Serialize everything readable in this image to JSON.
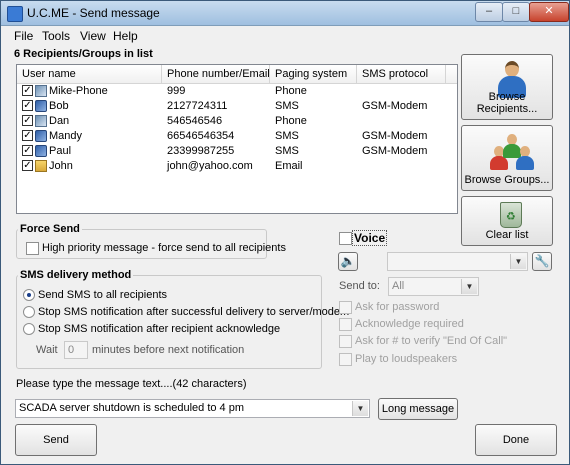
{
  "window": {
    "title": "U.C.ME - Send message"
  },
  "menu": [
    "File",
    "Tools",
    "View",
    "Help"
  ],
  "recipients": {
    "heading": "6 Recipients/Groups in list",
    "columns": [
      "User name",
      "Phone number/Email",
      "Paging system",
      "SMS protocol"
    ],
    "rows": [
      {
        "name": "Mike-Phone",
        "number": "999",
        "system": "Phone",
        "protocol": "",
        "icon": "phone-icon"
      },
      {
        "name": "Bob",
        "number": "2127724311",
        "system": "SMS",
        "protocol": "GSM-Modem",
        "icon": "sms-icon"
      },
      {
        "name": "Dan",
        "number": "546546546",
        "system": "Phone",
        "protocol": "",
        "icon": "phone-icon"
      },
      {
        "name": "Mandy",
        "number": "66546546354",
        "system": "SMS",
        "protocol": "GSM-Modem",
        "icon": "sms-icon"
      },
      {
        "name": "Paul",
        "number": "23399987255",
        "system": "SMS",
        "protocol": "GSM-Modem",
        "icon": "sms-icon"
      },
      {
        "name": "John",
        "number": "john@yahoo.com",
        "system": "Email",
        "protocol": "",
        "icon": "email-icon"
      }
    ]
  },
  "side_buttons": {
    "browse_recipients": "Browse Recipients...",
    "browse_groups": "Browse Groups...",
    "clear_list": "Clear list"
  },
  "force_send": {
    "title": "Force Send",
    "option": "High priority message - force send to all recipients"
  },
  "sms_delivery": {
    "title": "SMS delivery method",
    "options": [
      "Send SMS to all recipients",
      "Stop SMS notification after successful delivery to server/modem",
      "Stop SMS notification after recipient acknowledge"
    ],
    "selected": 0,
    "wait_label": "Wait",
    "wait_value": "0",
    "wait_suffix": "minutes before next notification"
  },
  "voice": {
    "label": "Voice",
    "send_to_label": "Send to:",
    "send_to_value": "All",
    "options": [
      "Ask for password",
      "Acknowledge required",
      "Ask for # to verify \"End Of Call\"",
      "Play to loudspeakers"
    ]
  },
  "message": {
    "prompt": "Please type the message text....(42 characters)",
    "text": "SCADA server shutdown is scheduled to 4 pm",
    "long_button": "Long message"
  },
  "footer": {
    "send": "Send",
    "done": "Done"
  }
}
